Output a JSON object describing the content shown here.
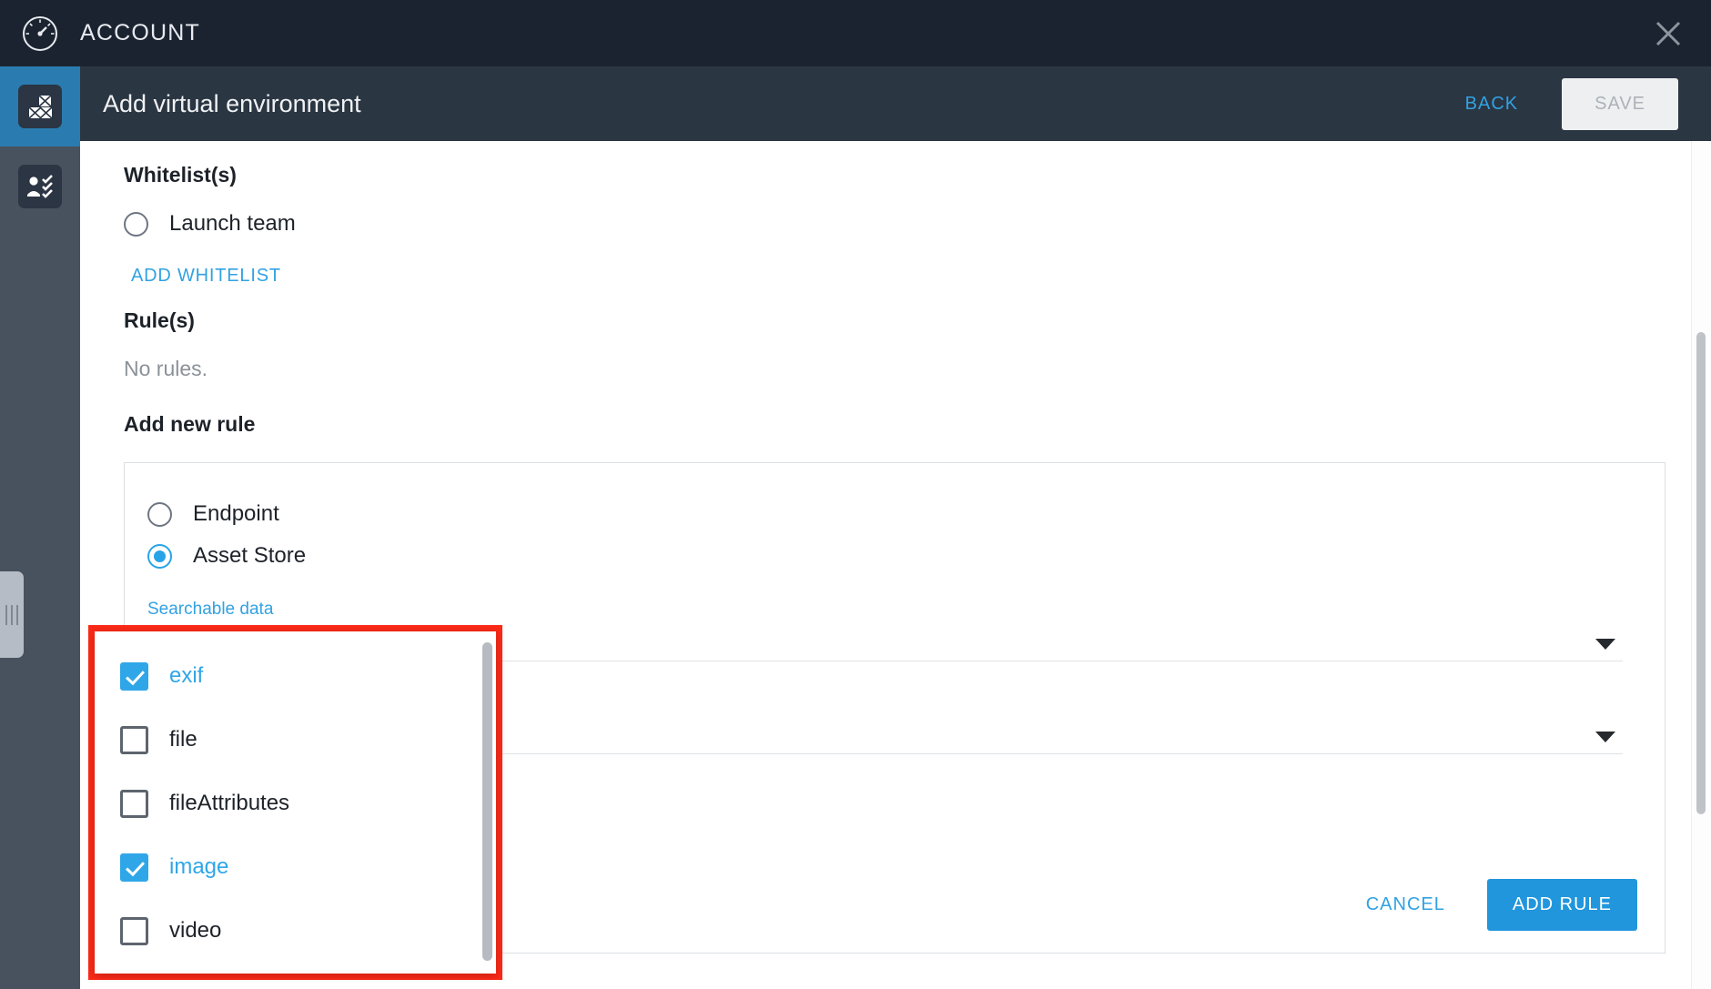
{
  "account_bar": {
    "title": "ACCOUNT",
    "logo_icon": "gauge-icon",
    "close_icon": "close-icon"
  },
  "rail": {
    "items": [
      {
        "icon": "virtual-environment-blocks-icon",
        "name": "virtual-environments",
        "active": true
      },
      {
        "icon": "user-checklist-icon",
        "name": "whitelists",
        "active": false
      }
    ],
    "handle_icon": "drag-handle-icon"
  },
  "sub_header": {
    "title": "Add virtual environment",
    "back_label": "BACK",
    "save_label": "SAVE"
  },
  "main": {
    "whitelists": {
      "heading": "Whitelist(s)",
      "options": [
        {
          "label": "Launch team",
          "checked": false
        }
      ],
      "add_label": "ADD WHITELIST"
    },
    "rules": {
      "heading": "Rule(s)",
      "empty_text": "No rules."
    },
    "add_new_rule": {
      "heading": "Add new rule",
      "type_options": [
        {
          "label": "Endpoint",
          "selected": false
        },
        {
          "label": "Asset Store",
          "selected": true
        }
      ],
      "fields": [
        {
          "label": "Searchable data",
          "value": "",
          "caret_icon": "chevron-down-icon"
        },
        {
          "label": "",
          "value": "",
          "caret_icon": "chevron-down-icon"
        }
      ],
      "cancel_label": "CANCEL",
      "add_rule_label": "ADD RULE"
    }
  },
  "dropdown": {
    "name": "searchable-data-dropdown",
    "items": [
      {
        "label": "exif",
        "checked": true
      },
      {
        "label": "file",
        "checked": false
      },
      {
        "label": "fileAttributes",
        "checked": false
      },
      {
        "label": "image",
        "checked": true
      },
      {
        "label": "video",
        "checked": false
      }
    ]
  },
  "colors": {
    "accent_blue": "#2fa6e8",
    "link_blue": "#31a2e2",
    "highlight_red": "#fb2a17",
    "header_dark": "#1b2330",
    "subheader_dark": "#2b3643",
    "rail_gray": "#48525e"
  }
}
